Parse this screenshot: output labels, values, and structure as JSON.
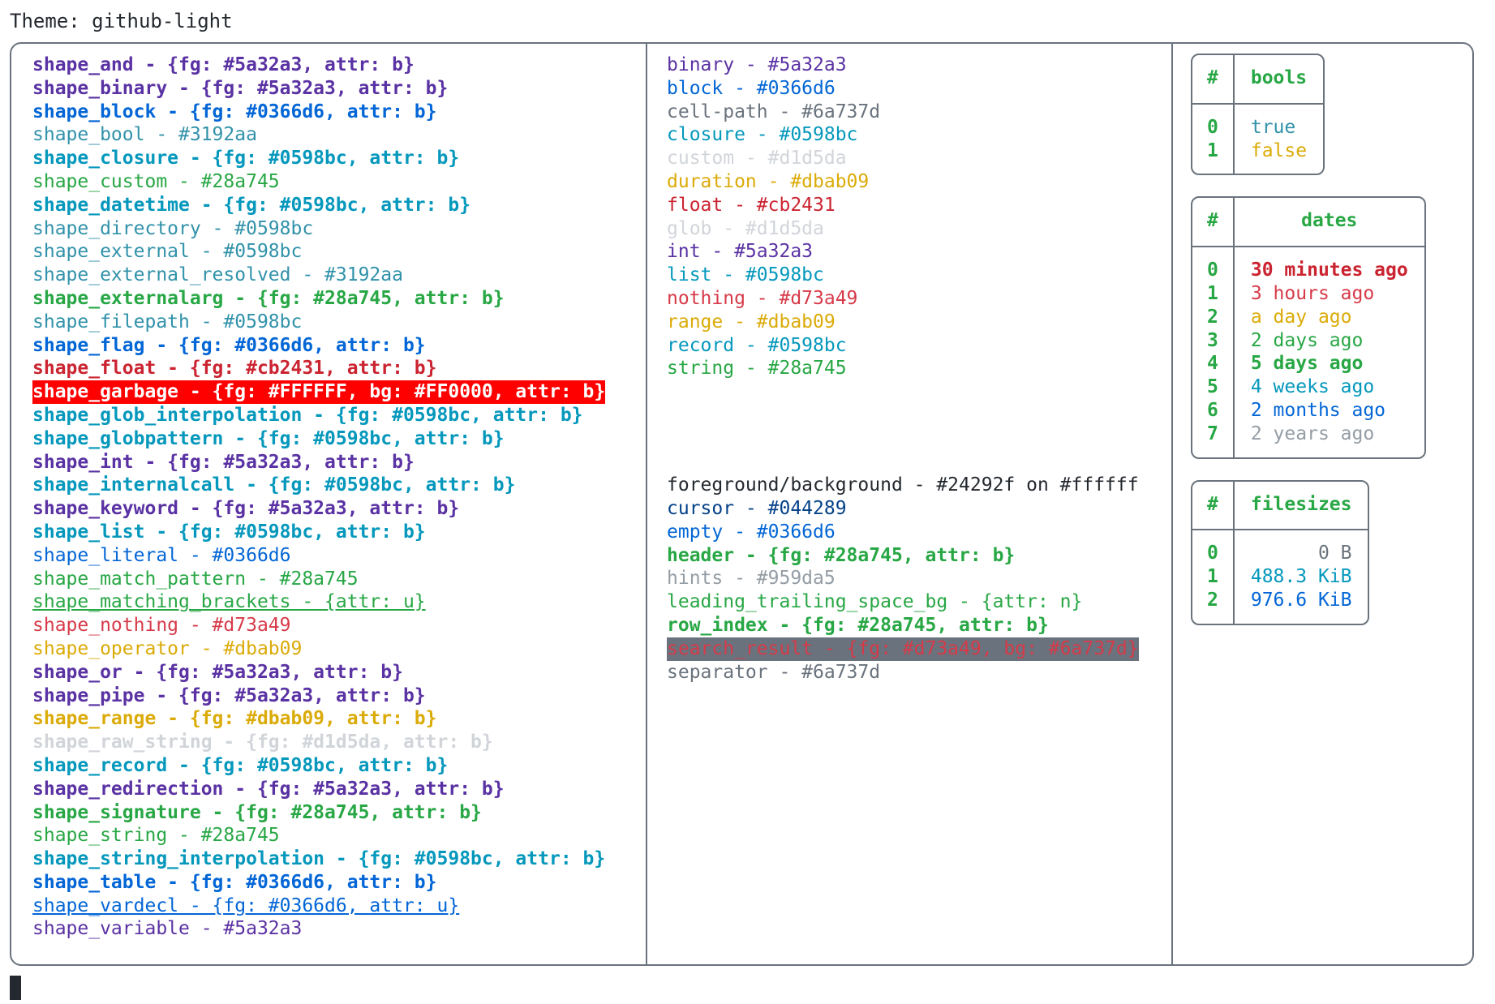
{
  "header": {
    "theme_label": "Theme: github-light"
  },
  "colors": {
    "purple": "#5a32a3",
    "blue": "#0366d6",
    "teal_light": "#3192aa",
    "teal": "#0598bc",
    "green": "#28a745",
    "red": "#cb2431",
    "red_bright": "#d73a49",
    "amber": "#dbab09",
    "gray": "#6a737d",
    "gray_light": "#d1d5da",
    "gray_hint": "#959da5",
    "cursor_blue": "#044289",
    "fg": "#24292f",
    "bg": "#ffffff",
    "garbage_bg": "#FF0000",
    "garbage_fg": "#FFFFFF"
  },
  "shapes": [
    {
      "text": "shape_and - {fg: #5a32a3, attr: b}",
      "color": "#5a32a3",
      "bold": true
    },
    {
      "text": "shape_binary - {fg: #5a32a3, attr: b}",
      "color": "#5a32a3",
      "bold": true
    },
    {
      "text": "shape_block - {fg: #0366d6, attr: b}",
      "color": "#0366d6",
      "bold": true
    },
    {
      "text": "shape_bool - #3192aa",
      "color": "#3192aa",
      "bold": false
    },
    {
      "text": "shape_closure - {fg: #0598bc, attr: b}",
      "color": "#0598bc",
      "bold": true
    },
    {
      "text": "shape_custom - #28a745",
      "color": "#28a745",
      "bold": false
    },
    {
      "text": "shape_datetime - {fg: #0598bc, attr: b}",
      "color": "#0598bc",
      "bold": true
    },
    {
      "text": "shape_directory - #0598bc",
      "color": "#3192aa",
      "bold": false
    },
    {
      "text": "shape_external - #0598bc",
      "color": "#3192aa",
      "bold": false
    },
    {
      "text": "shape_external_resolved - #3192aa",
      "color": "#3192aa",
      "bold": false
    },
    {
      "text": "shape_externalarg - {fg: #28a745, attr: b}",
      "color": "#28a745",
      "bold": true
    },
    {
      "text": "shape_filepath - #0598bc",
      "color": "#3192aa",
      "bold": false
    },
    {
      "text": "shape_flag - {fg: #0366d6, attr: b}",
      "color": "#0366d6",
      "bold": true
    },
    {
      "text": "shape_float - {fg: #cb2431, attr: b}",
      "color": "#cb2431",
      "bold": true
    },
    {
      "text": "shape_garbage - {fg: #FFFFFF, bg: #FF0000, attr: b}",
      "color": "#FFFFFF",
      "bg": "#FF0000",
      "bold": true
    },
    {
      "text": "shape_glob_interpolation - {fg: #0598bc, attr: b}",
      "color": "#0598bc",
      "bold": true
    },
    {
      "text": "shape_globpattern - {fg: #0598bc, attr: b}",
      "color": "#0598bc",
      "bold": true
    },
    {
      "text": "shape_int - {fg: #5a32a3, attr: b}",
      "color": "#5a32a3",
      "bold": true
    },
    {
      "text": "shape_internalcall - {fg: #0598bc, attr: b}",
      "color": "#0598bc",
      "bold": true
    },
    {
      "text": "shape_keyword - {fg: #5a32a3, attr: b}",
      "color": "#5a32a3",
      "bold": true
    },
    {
      "text": "shape_list - {fg: #0598bc, attr: b}",
      "color": "#0598bc",
      "bold": true
    },
    {
      "text": "shape_literal - #0366d6",
      "color": "#0366d6",
      "bold": false
    },
    {
      "text": "shape_match_pattern - #28a745",
      "color": "#28a745",
      "bold": false
    },
    {
      "text": "shape_matching_brackets - {attr: u}",
      "color": "#28a745",
      "bold": false,
      "underline": true
    },
    {
      "text": "shape_nothing - #d73a49",
      "color": "#d73a49",
      "bold": false
    },
    {
      "text": "shape_operator - #dbab09",
      "color": "#dbab09",
      "bold": false
    },
    {
      "text": "shape_or - {fg: #5a32a3, attr: b}",
      "color": "#5a32a3",
      "bold": true
    },
    {
      "text": "shape_pipe - {fg: #5a32a3, attr: b}",
      "color": "#5a32a3",
      "bold": true
    },
    {
      "text": "shape_range - {fg: #dbab09, attr: b}",
      "color": "#dbab09",
      "bold": true
    },
    {
      "text": "shape_raw_string - {fg: #d1d5da, attr: b}",
      "color": "#d1d5da",
      "bold": true
    },
    {
      "text": "shape_record - {fg: #0598bc, attr: b}",
      "color": "#0598bc",
      "bold": true
    },
    {
      "text": "shape_redirection - {fg: #5a32a3, attr: b}",
      "color": "#5a32a3",
      "bold": true
    },
    {
      "text": "shape_signature - {fg: #28a745, attr: b}",
      "color": "#28a745",
      "bold": true
    },
    {
      "text": "shape_string - #28a745",
      "color": "#28a745",
      "bold": false
    },
    {
      "text": "shape_string_interpolation - {fg: #0598bc, attr: b}",
      "color": "#0598bc",
      "bold": true
    },
    {
      "text": "shape_table - {fg: #0366d6, attr: b}",
      "color": "#0366d6",
      "bold": true
    },
    {
      "text": "shape_vardecl - {fg: #0366d6, attr: u}",
      "color": "#0366d6",
      "bold": false,
      "underline": true
    },
    {
      "text": "shape_variable - #5a32a3",
      "color": "#5a32a3",
      "bold": false
    }
  ],
  "types": [
    {
      "text": "binary - #5a32a3",
      "color": "#5a32a3",
      "bold": false
    },
    {
      "text": "block - #0366d6",
      "color": "#0366d6",
      "bold": false
    },
    {
      "text": "cell-path - #6a737d",
      "color": "#6a737d",
      "bold": false
    },
    {
      "text": "closure - #0598bc",
      "color": "#0598bc",
      "bold": false
    },
    {
      "text": "custom - #d1d5da",
      "color": "#d1d5da",
      "bold": false
    },
    {
      "text": "duration - #dbab09",
      "color": "#dbab09",
      "bold": false
    },
    {
      "text": "float - #cb2431",
      "color": "#cb2431",
      "bold": false
    },
    {
      "text": "glob - #d1d5da",
      "color": "#d1d5da",
      "bold": false
    },
    {
      "text": "int - #5a32a3",
      "color": "#5a32a3",
      "bold": false
    },
    {
      "text": "list - #0598bc",
      "color": "#0598bc",
      "bold": false
    },
    {
      "text": "nothing - #d73a49",
      "color": "#d73a49",
      "bold": false
    },
    {
      "text": "range - #dbab09",
      "color": "#dbab09",
      "bold": false
    },
    {
      "text": "record - #0598bc",
      "color": "#0598bc",
      "bold": false
    },
    {
      "text": "string - #28a745",
      "color": "#28a745",
      "bold": false
    }
  ],
  "ui_elements": [
    {
      "text": "foreground/background - #24292f on #ffffff",
      "color": "#24292f",
      "bold": false
    },
    {
      "text": "cursor - #044289",
      "color": "#044289",
      "bold": false
    },
    {
      "text": "empty - #0366d6",
      "color": "#0366d6",
      "bold": false
    },
    {
      "text": "header - {fg: #28a745, attr: b}",
      "color": "#28a745",
      "bold": true
    },
    {
      "text": "hints - #959da5",
      "color": "#959da5",
      "bold": false
    },
    {
      "text": "leading_trailing_space_bg - {attr: n}",
      "color": "#28a745",
      "bold": false
    },
    {
      "text": "row_index - {fg: #28a745, attr: b}",
      "color": "#28a745",
      "bold": true
    },
    {
      "text": "search_result - {fg: #d73a49, bg: #6a737d}",
      "color": "#d73a49",
      "bg": "#6a737d",
      "bold": false
    },
    {
      "text": "separator - #6a737d",
      "color": "#6a737d",
      "bold": false
    }
  ],
  "tables": [
    {
      "name": "bools",
      "index_header": "#",
      "value_header": "bools",
      "align": "left",
      "rows": [
        {
          "index": "0",
          "value": "true",
          "color": "#3192aa",
          "bold": false
        },
        {
          "index": "1",
          "value": "false",
          "color": "#dbab09",
          "bold": false
        }
      ]
    },
    {
      "name": "dates",
      "index_header": "#",
      "value_header": "dates",
      "align": "left",
      "rows": [
        {
          "index": "0",
          "value": "30 minutes ago",
          "color": "#cb2431",
          "bold": true
        },
        {
          "index": "1",
          "value": "3 hours ago",
          "color": "#d73a49",
          "bold": false
        },
        {
          "index": "2",
          "value": "a day ago",
          "color": "#dbab09",
          "bold": false
        },
        {
          "index": "3",
          "value": "2 days ago",
          "color": "#28a745",
          "bold": false
        },
        {
          "index": "4",
          "value": "5 days ago",
          "color": "#28a745",
          "bold": true
        },
        {
          "index": "5",
          "value": "4 weeks ago",
          "color": "#0598bc",
          "bold": false
        },
        {
          "index": "6",
          "value": "2 months ago",
          "color": "#0366d6",
          "bold": false
        },
        {
          "index": "7",
          "value": "2 years ago",
          "color": "#959da5",
          "bold": false
        }
      ]
    },
    {
      "name": "filesizes",
      "index_header": "#",
      "value_header": "filesizes",
      "align": "right",
      "rows": [
        {
          "index": "0",
          "value": "0 B",
          "color": "#6a737d",
          "bold": false
        },
        {
          "index": "1",
          "value": "488.3 KiB",
          "color": "#0598bc",
          "bold": false
        },
        {
          "index": "2",
          "value": "976.6 KiB",
          "color": "#0366d6",
          "bold": false
        }
      ]
    }
  ]
}
